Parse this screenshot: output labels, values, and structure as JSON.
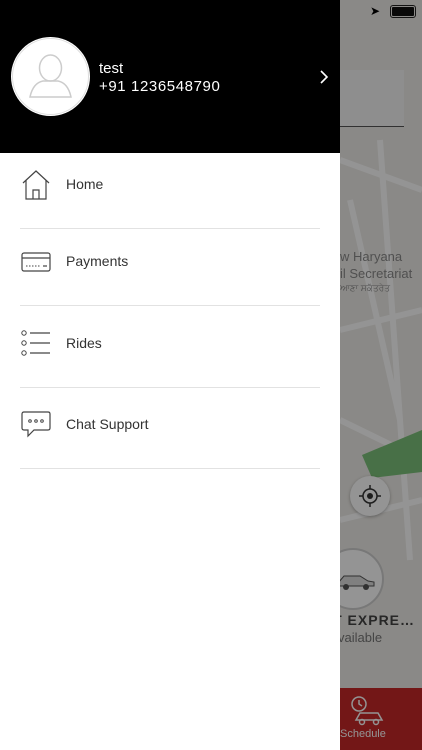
{
  "profile": {
    "name": "test",
    "phone": "+91 1236548790"
  },
  "menu": {
    "items": [
      {
        "label": "Home",
        "icon": "home-icon"
      },
      {
        "label": "Payments",
        "icon": "credit-card-icon"
      },
      {
        "label": "Rides",
        "icon": "list-icon"
      },
      {
        "label": "Chat Support",
        "icon": "chat-bubble-icon"
      }
    ]
  },
  "background": {
    "map_labels": [
      "w Haryana",
      "il Secretariat",
      "ਆਣਾ ਸਕੱਤਰੇਤ"
    ],
    "car_name": "RT EXPRE…",
    "car_status": "vailable",
    "schedule_label": "Schedule"
  },
  "colors": {
    "drawer_header": "#000000",
    "accent": "#c62828",
    "map_green": "#7dc27a"
  }
}
